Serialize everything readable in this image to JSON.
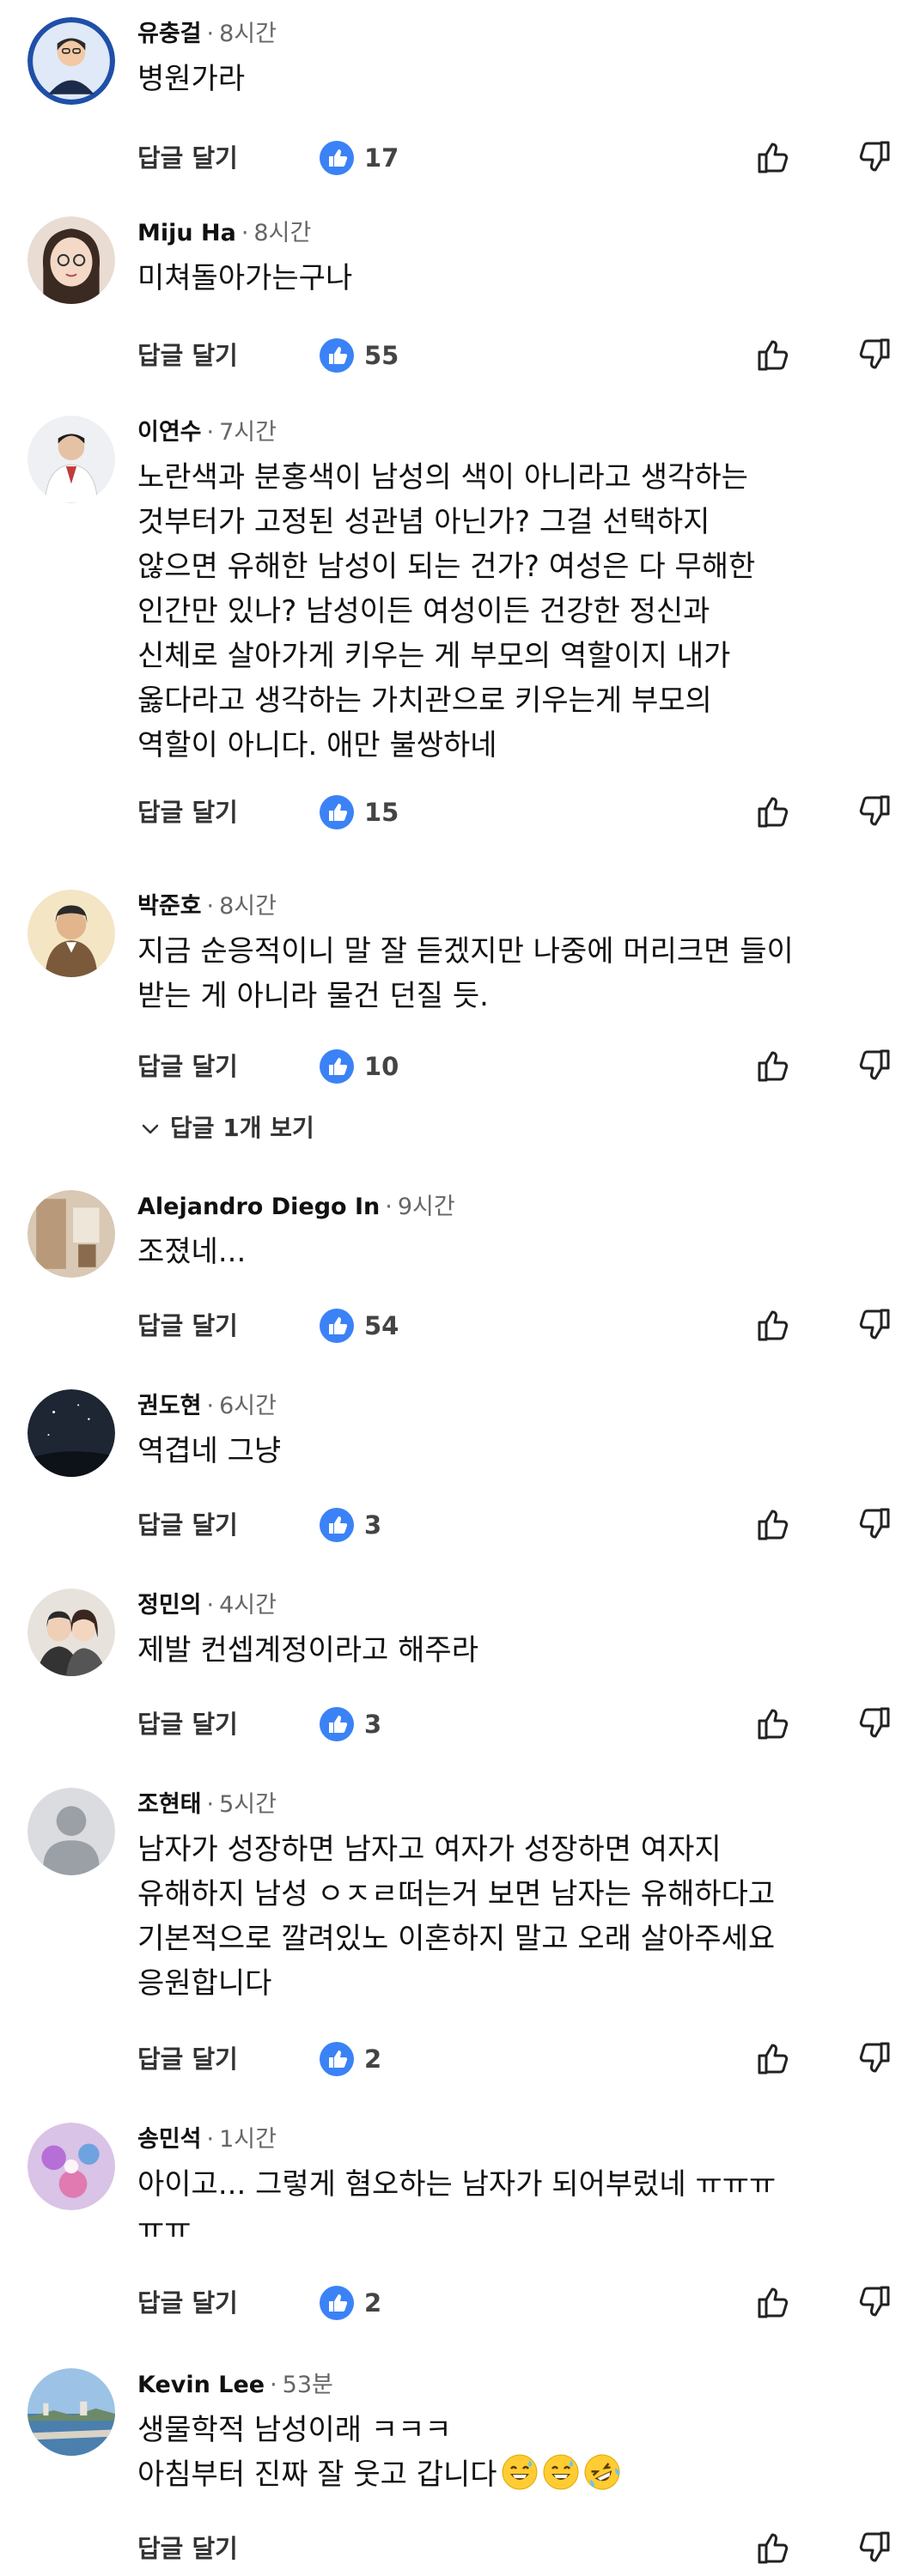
{
  "comments": [
    {
      "author": "유충걸",
      "time": "8시간",
      "text": "병원가라",
      "likes": "17",
      "reply_label": "답글 달기"
    },
    {
      "author": "Miju Ha",
      "time": "8시간",
      "text": "미쳐돌아가는구나",
      "likes": "55",
      "reply_label": "답글 달기"
    },
    {
      "author": "이연수",
      "time": "7시간",
      "text": "노란색과 분홍색이 남성의 색이 아니라고 생각하는\n것부터가 고정된 성관념 아닌가? 그걸 선택하지\n않으면 유해한 남성이 되는 건가? 여성은 다 무해한\n인간만 있나? 남성이든 여성이든 건강한 정신과\n신체로 살아가게 키우는 게 부모의 역할이지 내가\n옳다라고 생각하는 가치관으로 키우는게 부모의\n역할이 아니다. 애만 불쌍하네",
      "likes": "15",
      "reply_label": "답글 달기"
    },
    {
      "author": "박준호",
      "time": "8시간",
      "text": "지금 순응적이니 말 잘 듣겠지만 나중에 머리크면 들이\n받는 게 아니라 물건 던질 듯.",
      "likes": "10",
      "reply_label": "답글 달기",
      "replies_label": "답글 1개 보기"
    },
    {
      "author": "Alejandro Diego In",
      "time": "9시간",
      "text": "조졌네...",
      "likes": "54",
      "reply_label": "답글 달기"
    },
    {
      "author": "권도현",
      "time": "6시간",
      "text": "역겹네 그냥",
      "likes": "3",
      "reply_label": "답글 달기"
    },
    {
      "author": "정민의",
      "time": "4시간",
      "text": "제발 컨셉계정이라고 해주라",
      "likes": "3",
      "reply_label": "답글 달기"
    },
    {
      "author": "조현태",
      "time": "5시간",
      "text": "남자가 성장하면 남자고 여자가 성장하면 여자지\n유해하지 남성 ㅇㅈㄹ떠는거 보면 남자는 유해하다고\n기본적으로 깔려있노 이혼하지 말고 오래 살아주세요\n응원합니다",
      "likes": "2",
      "reply_label": "답글 달기"
    },
    {
      "author": "송민석",
      "time": "1시간",
      "text": "아이고... 그렇게 혐오하는 남자가 되어부렀네 ㅠㅠㅠ\nㅠㅠ",
      "likes": "2",
      "reply_label": "답글 달기"
    },
    {
      "author": "Kevin Lee",
      "time": "53분",
      "text": "생물학적 남성이래 ㅋㅋㅋ\n아침부터 진짜 잘 웃고 갑니다",
      "likes": "",
      "reply_label": "답글 달기",
      "emojis": [
        "grinning-sweat-emoji",
        "grinning-sweat-emoji",
        "rolling-laughing-emoji"
      ]
    }
  ],
  "separator": "·",
  "colors": {
    "like_blue": "#3b82f6",
    "text": "#111111",
    "muted": "#666666"
  }
}
